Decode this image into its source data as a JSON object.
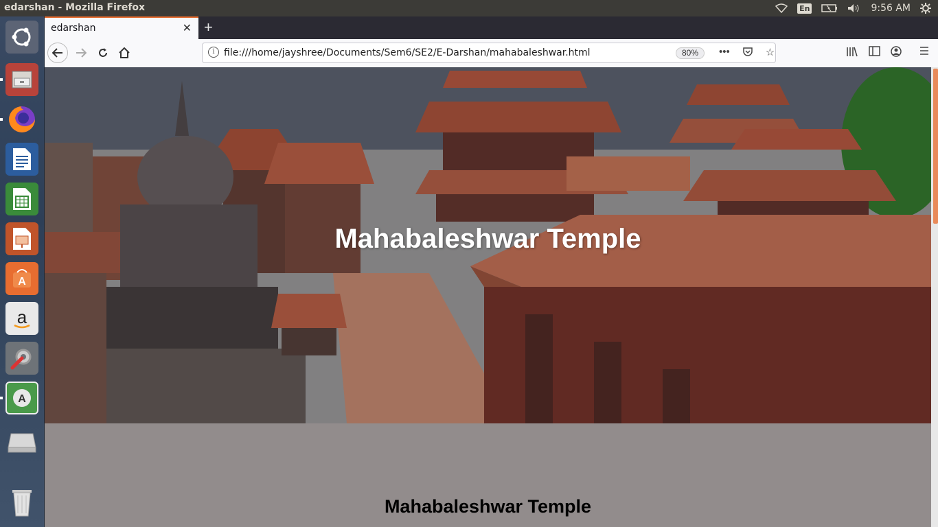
{
  "top_panel": {
    "window_title": "edarshan - Mozilla Firefox",
    "keyboard_layout": "En",
    "clock": "9:56 AM"
  },
  "launcher": {
    "items": [
      {
        "name": "Ubuntu dash",
        "icon": "ubuntu-logo-icon"
      },
      {
        "name": "Files",
        "icon": "file-cabinet-icon"
      },
      {
        "name": "Firefox",
        "icon": "firefox-icon"
      },
      {
        "name": "LibreOffice Writer",
        "icon": "writer-icon"
      },
      {
        "name": "LibreOffice Calc",
        "icon": "calc-icon"
      },
      {
        "name": "LibreOffice Impress",
        "icon": "impress-icon"
      },
      {
        "name": "Ubuntu Software",
        "icon": "software-center-icon"
      },
      {
        "name": "Amazon",
        "icon": "amazon-icon"
      },
      {
        "name": "System Settings",
        "icon": "settings-icon"
      },
      {
        "name": "Software Updater",
        "icon": "updater-icon"
      },
      {
        "name": "Disk",
        "icon": "disk-icon"
      },
      {
        "name": "Trash",
        "icon": "trash-icon"
      }
    ]
  },
  "browser": {
    "tab": {
      "label": "edarshan"
    },
    "url": "file:///home/jayshree/Documents/Sem6/SE2/E-Darshan/mahabaleshwar.html",
    "zoom": "80%"
  },
  "page": {
    "hero_title": "Mahabaleshwar Temple",
    "section_title": "Mahabaleshwar Temple"
  },
  "colors": {
    "accent_tab": "#e66b2e",
    "section_bg": "#928c8c"
  }
}
